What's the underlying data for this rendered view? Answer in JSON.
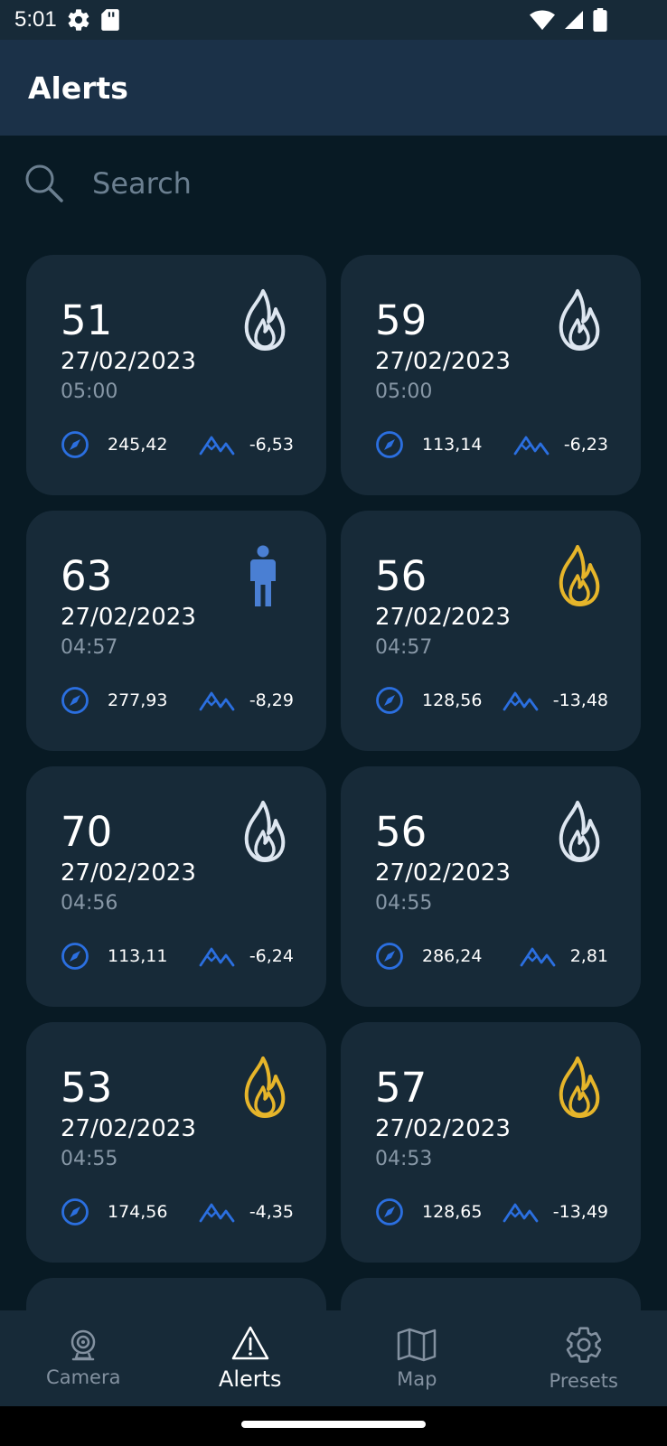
{
  "status_bar": {
    "time": "5:01"
  },
  "app_bar": {
    "title": "Alerts"
  },
  "search": {
    "placeholder": "Search",
    "value": ""
  },
  "colors": {
    "background": "#081a24",
    "card": "#172a38",
    "app_bar": "#1b3148",
    "accent_blue": "#2b6fe0",
    "fire_white": "#dde6f0",
    "fire_yellow": "#e6b52a",
    "person_blue": "#4a7fd3"
  },
  "alerts": [
    {
      "count": "51",
      "date": "27/02/2023",
      "time": "05:00",
      "type": "fire-white",
      "azimuth": "245,42",
      "elevation": "-6,53"
    },
    {
      "count": "59",
      "date": "27/02/2023",
      "time": "05:00",
      "type": "fire-white",
      "azimuth": "113,14",
      "elevation": "-6,23"
    },
    {
      "count": "63",
      "date": "27/02/2023",
      "time": "04:57",
      "type": "person",
      "azimuth": "277,93",
      "elevation": "-8,29"
    },
    {
      "count": "56",
      "date": "27/02/2023",
      "time": "04:57",
      "type": "fire-yellow",
      "azimuth": "128,56",
      "elevation": "-13,48"
    },
    {
      "count": "70",
      "date": "27/02/2023",
      "time": "04:56",
      "type": "fire-white",
      "azimuth": "113,11",
      "elevation": "-6,24"
    },
    {
      "count": "56",
      "date": "27/02/2023",
      "time": "04:55",
      "type": "fire-white",
      "azimuth": "286,24",
      "elevation": "2,81"
    },
    {
      "count": "53",
      "date": "27/02/2023",
      "time": "04:55",
      "type": "fire-yellow",
      "azimuth": "174,56",
      "elevation": "-4,35"
    },
    {
      "count": "57",
      "date": "27/02/2023",
      "time": "04:53",
      "type": "fire-yellow",
      "azimuth": "128,65",
      "elevation": "-13,49"
    }
  ],
  "bottom_nav": {
    "items": [
      {
        "label": "Camera",
        "icon": "camera-icon",
        "active": false
      },
      {
        "label": "Alerts",
        "icon": "alert-triangle-icon",
        "active": true
      },
      {
        "label": "Map",
        "icon": "map-icon",
        "active": false
      },
      {
        "label": "Presets",
        "icon": "gear-icon",
        "active": false
      }
    ]
  }
}
